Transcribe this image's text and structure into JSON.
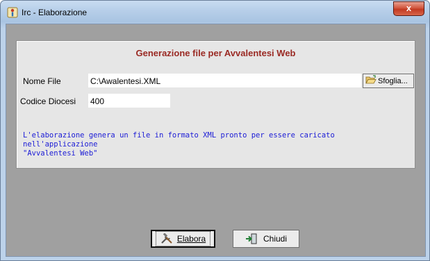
{
  "window": {
    "title": "Irc - Elaborazione",
    "close_label": "x",
    "icons": {
      "app": "app-icon",
      "close": "close-icon"
    }
  },
  "panel": {
    "title": "Generazione file per Avvalentesi Web",
    "nome_file_label": "Nome File",
    "nome_file_value": "C:\\Awalentesi.XML",
    "codice_diocesi_label": "Codice Diocesi",
    "codice_diocesi_value": "400",
    "browse_label": "Sfoglia...",
    "info_line1": "L'elaborazione genera un file in formato XML pronto per essere caricato nell'applicazione",
    "info_line2": "\"Avvalentesi Web\""
  },
  "buttons": {
    "elabora_label": "Elabora",
    "chiudi_label": "Chiudi"
  },
  "colors": {
    "panel_title": "#9a2a24",
    "info_text": "#1c1cd6",
    "client_bg": "#a0a0a0"
  }
}
